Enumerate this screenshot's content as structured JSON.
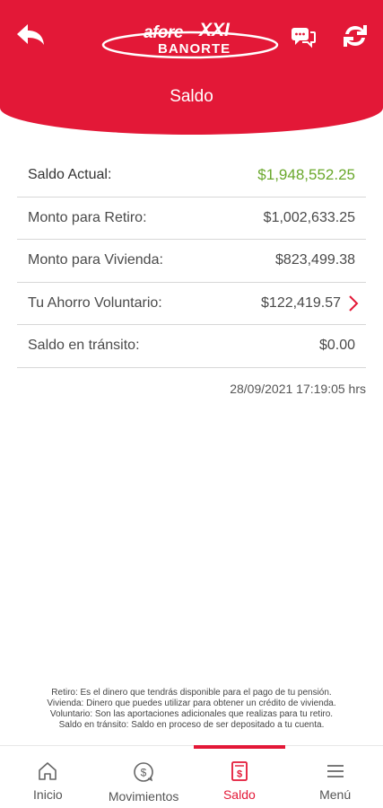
{
  "header": {
    "title": "Saldo",
    "logo_afore": "afore",
    "logo_xxi": "XXI",
    "logo_banorte": "BANORTE",
    "back_icon": "back-arrow-icon",
    "chat_icon": "chat-icon",
    "refresh_icon": "refresh-icon",
    "color": "#e31837"
  },
  "balances": [
    {
      "label": "Saldo Actual:",
      "value": "$1,948,552.25",
      "highlight": true
    },
    {
      "label": "Monto para Retiro:",
      "value": "$1,002,633.25"
    },
    {
      "label": "Monto para Vivienda:",
      "value": "$823,499.38"
    },
    {
      "label": "Tu Ahorro Voluntario:",
      "value": "$122,419.57",
      "link": true
    },
    {
      "label": "Saldo en tránsito:",
      "value": "$0.00"
    }
  ],
  "timestamp": "28/09/2021 17:19:05 hrs",
  "notes": [
    "Retiro: Es el dinero que tendrás disponible para el pago de tu pensión.",
    "Vivienda: Dinero que puedes utilizar para obtener un crédito de vivienda.",
    "Voluntario: Son las aportaciones adicionales que realizas para tu retiro.",
    "Saldo en tránsito: Saldo en proceso de ser depositado a tu cuenta."
  ],
  "nav": [
    {
      "label": "Inicio",
      "icon": "home-icon"
    },
    {
      "label": "Movimientos",
      "icon": "movements-icon"
    },
    {
      "label": "Saldo",
      "icon": "balance-icon",
      "active": true
    },
    {
      "label": "Menú",
      "icon": "menu-icon"
    }
  ],
  "colors": {
    "accent": "#e31837",
    "positive": "#6aa82c"
  }
}
